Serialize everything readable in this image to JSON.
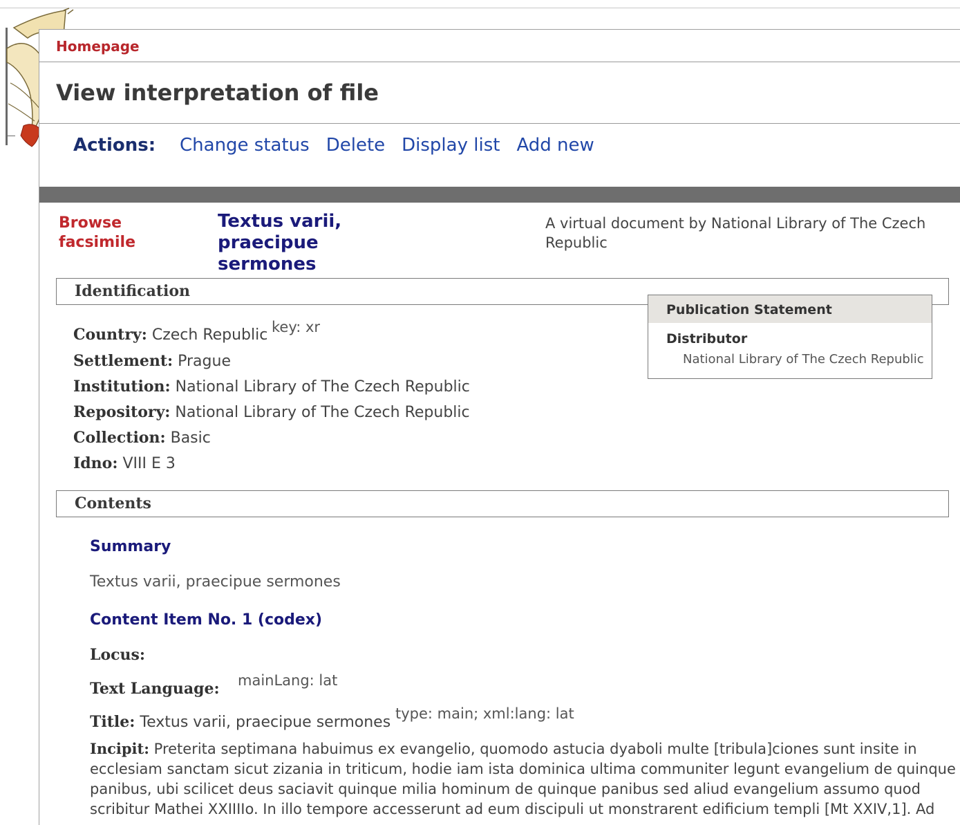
{
  "nav": {
    "homepage": "Homepage"
  },
  "page": {
    "title": "View interpretation of file"
  },
  "actions": {
    "label": "Actions:",
    "items": [
      "Change status",
      "Delete",
      "Display list",
      "Add new"
    ]
  },
  "document": {
    "browse_label_line1": "Browse",
    "browse_label_line2": "facsimile",
    "title_line1": "Textus varii, praecipue",
    "title_line2": "sermones",
    "description_line1": "A virtual document by National Library of The Czech",
    "description_line2": "Republic"
  },
  "identification": {
    "heading": "Identification",
    "country_label": "Country:",
    "country_value": "Czech Republic",
    "country_note": "key: xr",
    "settlement_label": "Settlement:",
    "settlement_value": "Prague",
    "institution_label": "Institution:",
    "institution_value": "National Library of The Czech Republic",
    "repository_label": "Repository:",
    "repository_value": "National Library of The Czech Republic",
    "collection_label": "Collection:",
    "collection_value": "Basic",
    "idno_label": "Idno:",
    "idno_value": "VIII E 3"
  },
  "publication": {
    "heading": "Publication Statement",
    "distributor_label": "Distributor",
    "distributor_value": "National Library of The Czech Republic"
  },
  "contents": {
    "heading": "Contents",
    "summary_heading": "Summary",
    "summary_text": "Textus varii, praecipue sermones",
    "item_heading": "Content Item No. 1 (codex)",
    "locus_label": "Locus:",
    "text_language_label": "Text Language:",
    "text_language_note": "mainLang: lat",
    "title_label": "Title:",
    "title_value": "Textus varii, praecipue sermones",
    "title_note": "type: main; xml:lang: lat",
    "incipit_label": "Incipit:",
    "incipit_text": "Preterita septimana habuimus ex evangelio, quomodo astucia dyaboli multe [tribula]ciones sunt insite in ecclesiam sanctam sicut zizania in triticum, hodie iam ista dominica ultima communiter legunt evangelium de quinque panibus, ubi scilicet deus saciavit quinque milia hominum de quinque panibus sed aliud evangelium assumo quod scribitur Mathei XXIIIIo. In illo tempore accesserunt ad eum discipuli ut monstrarent edificium templi [Mt XXIV,1]. Ad"
  }
}
